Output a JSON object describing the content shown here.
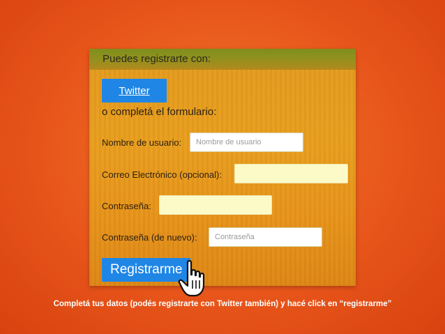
{
  "form": {
    "title": "Puedes registrarte con:",
    "twitter_label": "Twitter",
    "or_text": "o completá el formulario:",
    "fields": {
      "username": {
        "label": "Nombre de usuario:",
        "placeholder": "Nombre de usuario"
      },
      "email": {
        "label": "Correo Electrónico (opcional):",
        "placeholder": ""
      },
      "password": {
        "label": "Contraseña:",
        "placeholder": ""
      },
      "password_repeat": {
        "label": "Contraseña (de nuevo):",
        "placeholder": "Contraseña"
      }
    },
    "register_label": "Registrarme"
  },
  "caption": "Completá tus datos (podés registrarte con Twitter también) y hacé click en “registrarme”",
  "colors": {
    "background": "#e8561b",
    "panel": "#e89e1e",
    "button": "#1f86e6",
    "caption": "#ffffff"
  },
  "icons": [
    "hand-pointer-cursor-icon"
  ]
}
